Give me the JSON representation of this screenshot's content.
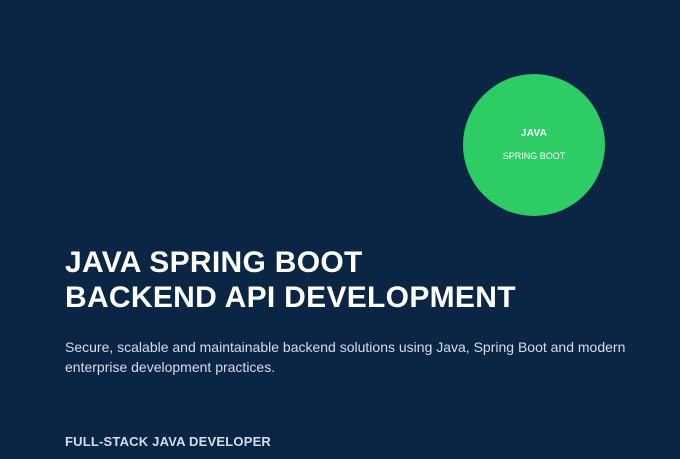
{
  "badge": {
    "title": "JAVA",
    "subtitle": "SPRING BOOT",
    "color": "#2ecc64"
  },
  "headline": {
    "line1": "JAVA SPRING BOOT",
    "line2": "BACKEND API DEVELOPMENT"
  },
  "description": "Secure, scalable and maintainable backend solutions using Java, Spring Boot and modern enterprise development practices.",
  "role": "FULL-STACK JAVA DEVELOPER",
  "colors": {
    "background": "#0b2545",
    "text": "#ffffff",
    "muted_text": "#d6dde8"
  }
}
